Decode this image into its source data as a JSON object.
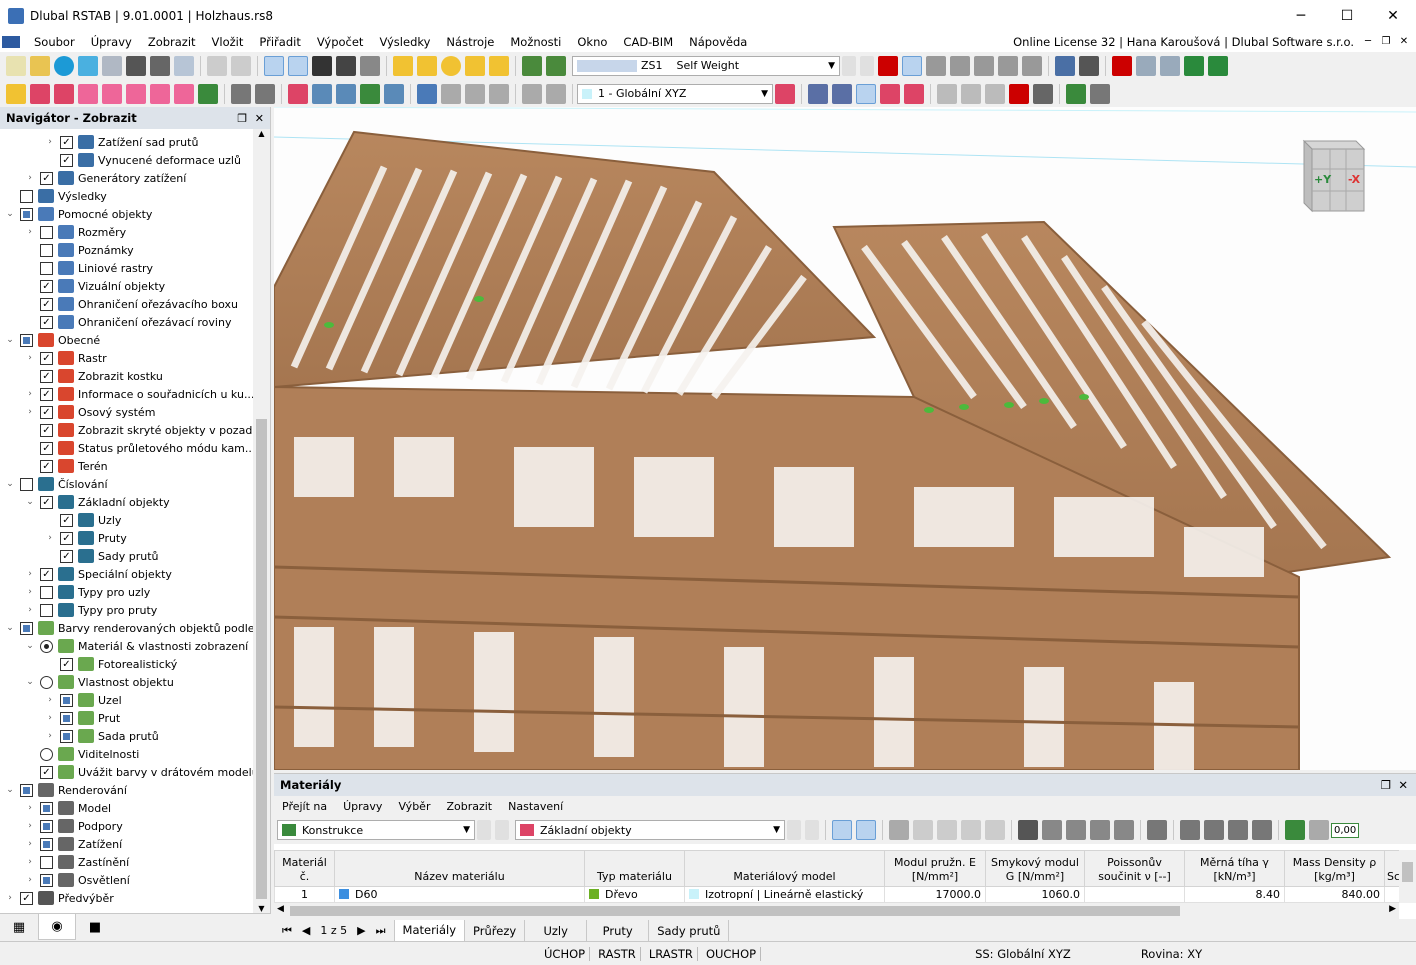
{
  "window": {
    "title": "Dlubal RSTAB | 9.01.0001 | Holzhaus.rs8",
    "minimize": "─",
    "maximize": "☐",
    "close": "✕"
  },
  "menu": {
    "items": [
      "Soubor",
      "Úpravy",
      "Zobrazit",
      "Vložit",
      "Přiřadit",
      "Výpočet",
      "Výsledky",
      "Nástroje",
      "Možnosti",
      "Okno",
      "CAD-BIM",
      "Nápověda"
    ],
    "license": "Online License 32 | Hana Karoušová | Dlubal Software s.r.o."
  },
  "toolbar": {
    "load_case_id": "ZS1",
    "load_case_name": "Self Weight",
    "coord_system": "1 - Globální XYZ"
  },
  "navigator": {
    "title": "Navigátor - Zobrazit",
    "items": [
      {
        "label": "Zatížení sad prutů",
        "level": 2,
        "exp": "›",
        "state": "checked",
        "color": "#3a6ea5"
      },
      {
        "label": "Vynucené deformace uzlů",
        "level": 2,
        "exp": "",
        "state": "checked",
        "color": "#3a6ea5"
      },
      {
        "label": "Generátory zatížení",
        "level": 1,
        "exp": "›",
        "state": "checked",
        "color": "#3a6ea5"
      },
      {
        "label": "Výsledky",
        "level": 0,
        "exp": "",
        "state": "unchecked",
        "color": "#3a6ea5"
      },
      {
        "label": "Pomocné objekty",
        "level": 0,
        "exp": "⌄",
        "state": "partial",
        "color": "#4a7ab8"
      },
      {
        "label": "Rozměry",
        "level": 1,
        "exp": "›",
        "state": "unchecked",
        "color": "#4a7ab8"
      },
      {
        "label": "Poznámky",
        "level": 1,
        "exp": "",
        "state": "unchecked",
        "color": "#4a7ab8"
      },
      {
        "label": "Liniové rastry",
        "level": 1,
        "exp": "",
        "state": "unchecked",
        "color": "#4a7ab8"
      },
      {
        "label": "Vizuální objekty",
        "level": 1,
        "exp": "",
        "state": "checked",
        "color": "#4a7ab8"
      },
      {
        "label": "Ohraničení ořezávacího boxu",
        "level": 1,
        "exp": "",
        "state": "checked",
        "color": "#4a7ab8"
      },
      {
        "label": "Ohraničení ořezávací roviny",
        "level": 1,
        "exp": "",
        "state": "checked",
        "color": "#4a7ab8"
      },
      {
        "label": "Obecné",
        "level": 0,
        "exp": "⌄",
        "state": "partial",
        "color": "#d9462e"
      },
      {
        "label": "Rastr",
        "level": 1,
        "exp": "›",
        "state": "checked",
        "color": "#d9462e"
      },
      {
        "label": "Zobrazit kostku",
        "level": 1,
        "exp": "",
        "state": "checked",
        "color": "#d9462e"
      },
      {
        "label": "Informace o souřadnicích u ku...",
        "level": 1,
        "exp": "›",
        "state": "checked",
        "color": "#d9462e"
      },
      {
        "label": "Osový systém",
        "level": 1,
        "exp": "›",
        "state": "checked",
        "color": "#d9462e"
      },
      {
        "label": "Zobrazit skryté objekty v pozadí",
        "level": 1,
        "exp": "",
        "state": "checked",
        "color": "#d9462e"
      },
      {
        "label": "Status průletového módu kam...",
        "level": 1,
        "exp": "",
        "state": "checked",
        "color": "#d9462e"
      },
      {
        "label": "Terén",
        "level": 1,
        "exp": "",
        "state": "checked",
        "color": "#d9462e"
      },
      {
        "label": "Číslování",
        "level": 0,
        "exp": "⌄",
        "state": "unchecked",
        "color": "#2a6f8f"
      },
      {
        "label": "Základní objekty",
        "level": 1,
        "exp": "⌄",
        "state": "checked",
        "color": "#2a6f8f"
      },
      {
        "label": "Uzly",
        "level": 2,
        "exp": "",
        "state": "checked",
        "color": "#2a6f8f"
      },
      {
        "label": "Pruty",
        "level": 2,
        "exp": "›",
        "state": "checked",
        "color": "#2a6f8f"
      },
      {
        "label": "Sady prutů",
        "level": 2,
        "exp": "",
        "state": "checked",
        "color": "#2a6f8f"
      },
      {
        "label": "Speciální objekty",
        "level": 1,
        "exp": "›",
        "state": "checked",
        "color": "#2a6f8f"
      },
      {
        "label": "Typy pro uzly",
        "level": 1,
        "exp": "›",
        "state": "unchecked",
        "color": "#2a6f8f"
      },
      {
        "label": "Typy pro pruty",
        "level": 1,
        "exp": "›",
        "state": "unchecked",
        "color": "#2a6f8f"
      },
      {
        "label": "Barvy renderovaných objektů podle",
        "level": 0,
        "exp": "⌄",
        "state": "partial",
        "color": "#6aa84f"
      },
      {
        "label": "Materiál & vlastnosti zobrazení",
        "level": 1,
        "exp": "⌄",
        "state": "radio-on",
        "color": "#6aa84f"
      },
      {
        "label": "Fotorealistický",
        "level": 2,
        "exp": "",
        "state": "checked",
        "color": "#6aa84f"
      },
      {
        "label": "Vlastnost objektu",
        "level": 1,
        "exp": "⌄",
        "state": "radio-off",
        "color": "#6aa84f"
      },
      {
        "label": "Uzel",
        "level": 2,
        "exp": "›",
        "state": "partial",
        "color": "#6aa84f"
      },
      {
        "label": "Prut",
        "level": 2,
        "exp": "›",
        "state": "partial",
        "color": "#6aa84f"
      },
      {
        "label": "Sada prutů",
        "level": 2,
        "exp": "›",
        "state": "partial",
        "color": "#6aa84f"
      },
      {
        "label": "Viditelnosti",
        "level": 1,
        "exp": "",
        "state": "radio-off",
        "color": "#6aa84f"
      },
      {
        "label": "Uvážit barvy v drátovém modelu",
        "level": 1,
        "exp": "",
        "state": "checked",
        "color": "#6aa84f"
      },
      {
        "label": "Renderování",
        "level": 0,
        "exp": "⌄",
        "state": "partial",
        "color": "#666666"
      },
      {
        "label": "Model",
        "level": 1,
        "exp": "›",
        "state": "partial",
        "color": "#666666"
      },
      {
        "label": "Podpory",
        "level": 1,
        "exp": "›",
        "state": "partial",
        "color": "#666666"
      },
      {
        "label": "Zatížení",
        "level": 1,
        "exp": "›",
        "state": "partial",
        "color": "#666666"
      },
      {
        "label": "Zastínění",
        "level": 1,
        "exp": "›",
        "state": "unchecked",
        "color": "#666666"
      },
      {
        "label": "Osvětlení",
        "level": 1,
        "exp": "›",
        "state": "partial",
        "color": "#666666"
      },
      {
        "label": "Předvýběr",
        "level": 0,
        "exp": "›",
        "state": "checked",
        "color": "#555555"
      }
    ]
  },
  "panel": {
    "title": "Materiály",
    "menu": [
      "Přejít na",
      "Úpravy",
      "Výběr",
      "Zobrazit",
      "Nastavení"
    ],
    "combo1": "Konstrukce",
    "combo2": "Základní objekty",
    "sum_label": "0,00",
    "columns": [
      "Materiál č.",
      "Název materiálu",
      "Typ materiálu",
      "Materiálový model",
      "Modul pružn. E [N/mm²]",
      "Smykový modul G [N/mm²]",
      "Poissonův součinit ν [--]",
      "Měrná tíha γ [kN/m³]",
      "Mass Density ρ [kg/m³]",
      "Sc"
    ],
    "rows": [
      {
        "no": "1",
        "name": "D60",
        "name_color": "#3c8fe0",
        "type": "Dřevo",
        "type_color": "#6bb022",
        "model": "Izotropní | Lineárně elastický",
        "model_color": "#c9f2fa",
        "E": "17000.0",
        "G": "1060.0",
        "nu": "",
        "gamma": "8.40",
        "rho": "840.00"
      }
    ],
    "pager": "1 z 5",
    "tabs": [
      "Materiály",
      "Průřezy",
      "Uzly",
      "Pruty",
      "Sady prutů"
    ]
  },
  "status": {
    "items": [
      "ÚCHOP",
      "RASTR",
      "LRASTR",
      "OUCHOP"
    ],
    "ss": "SS: Globální XYZ",
    "plane": "Rovina: XY"
  },
  "viewcube": {
    "plus_y": "+Y",
    "minus_x": "-X"
  }
}
